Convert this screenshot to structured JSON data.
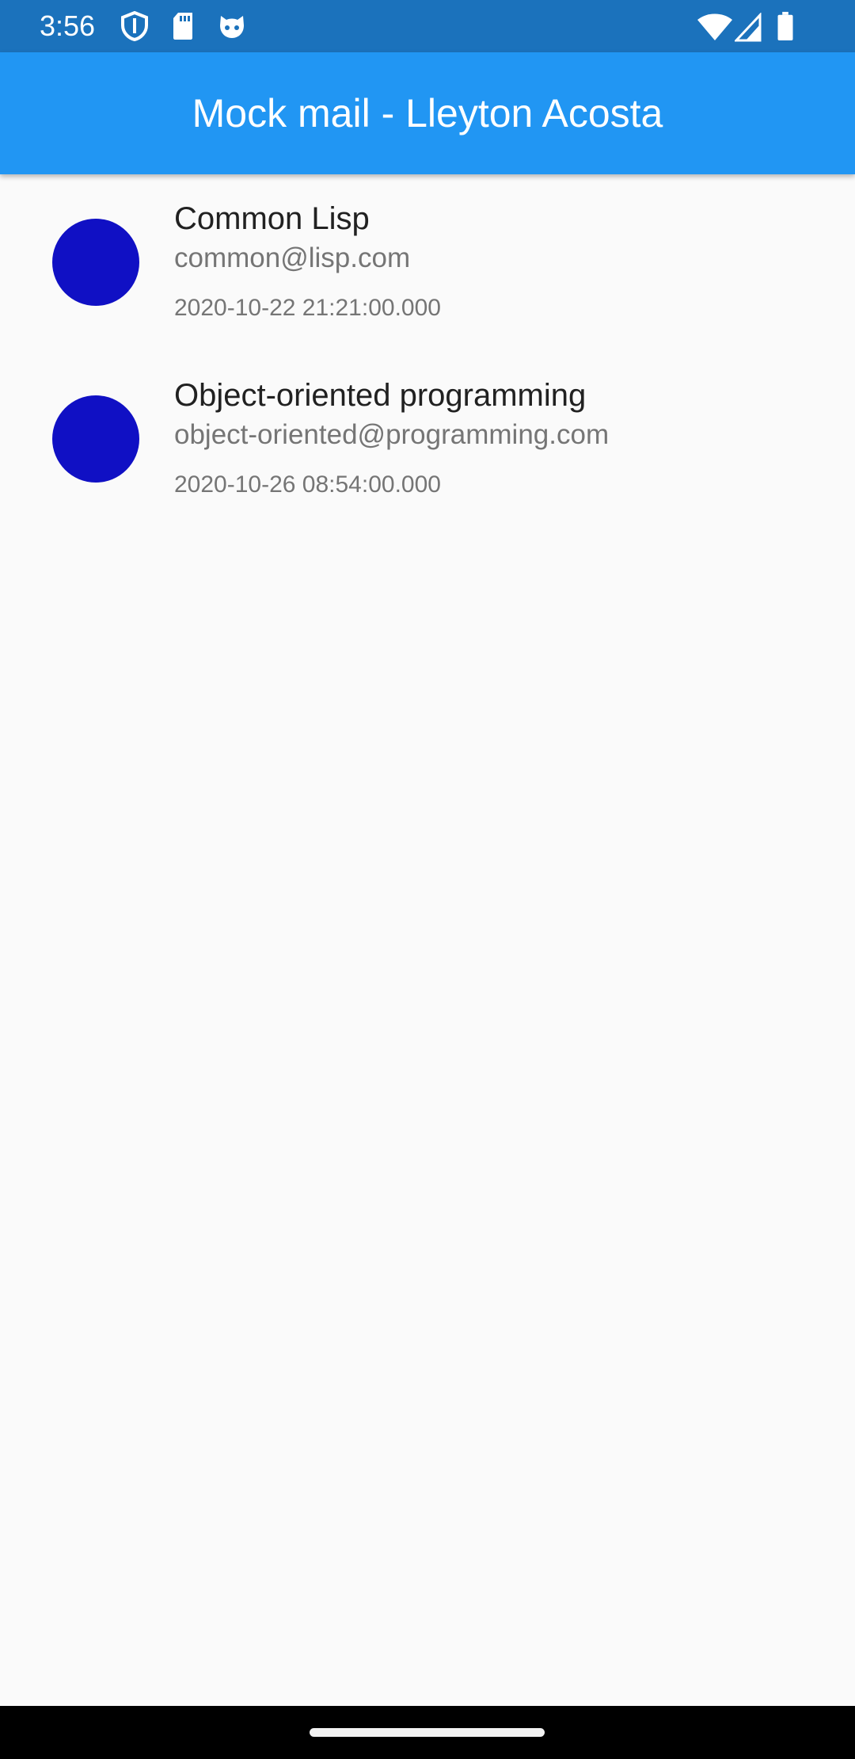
{
  "status_bar": {
    "time": "3:56",
    "left_icons": [
      "shield-icon",
      "sd-card-icon",
      "cat-face-icon"
    ],
    "right_icons": [
      "wifi-icon",
      "cellular-signal-icon",
      "battery-icon"
    ],
    "background": "#1b72bc"
  },
  "app_bar": {
    "title": "Mock mail - Lleyton Acosta",
    "background": "#2196f3"
  },
  "emails": [
    {
      "title": "Common Lisp",
      "email": "common@lisp.com",
      "date": "2020-10-22 21:21:00.000",
      "avatar_color": "#1010c4"
    },
    {
      "title": "Object-oriented programming",
      "email": "object-oriented@programming.com",
      "date": "2020-10-26 08:54:00.000",
      "avatar_color": "#1010c4"
    }
  ]
}
